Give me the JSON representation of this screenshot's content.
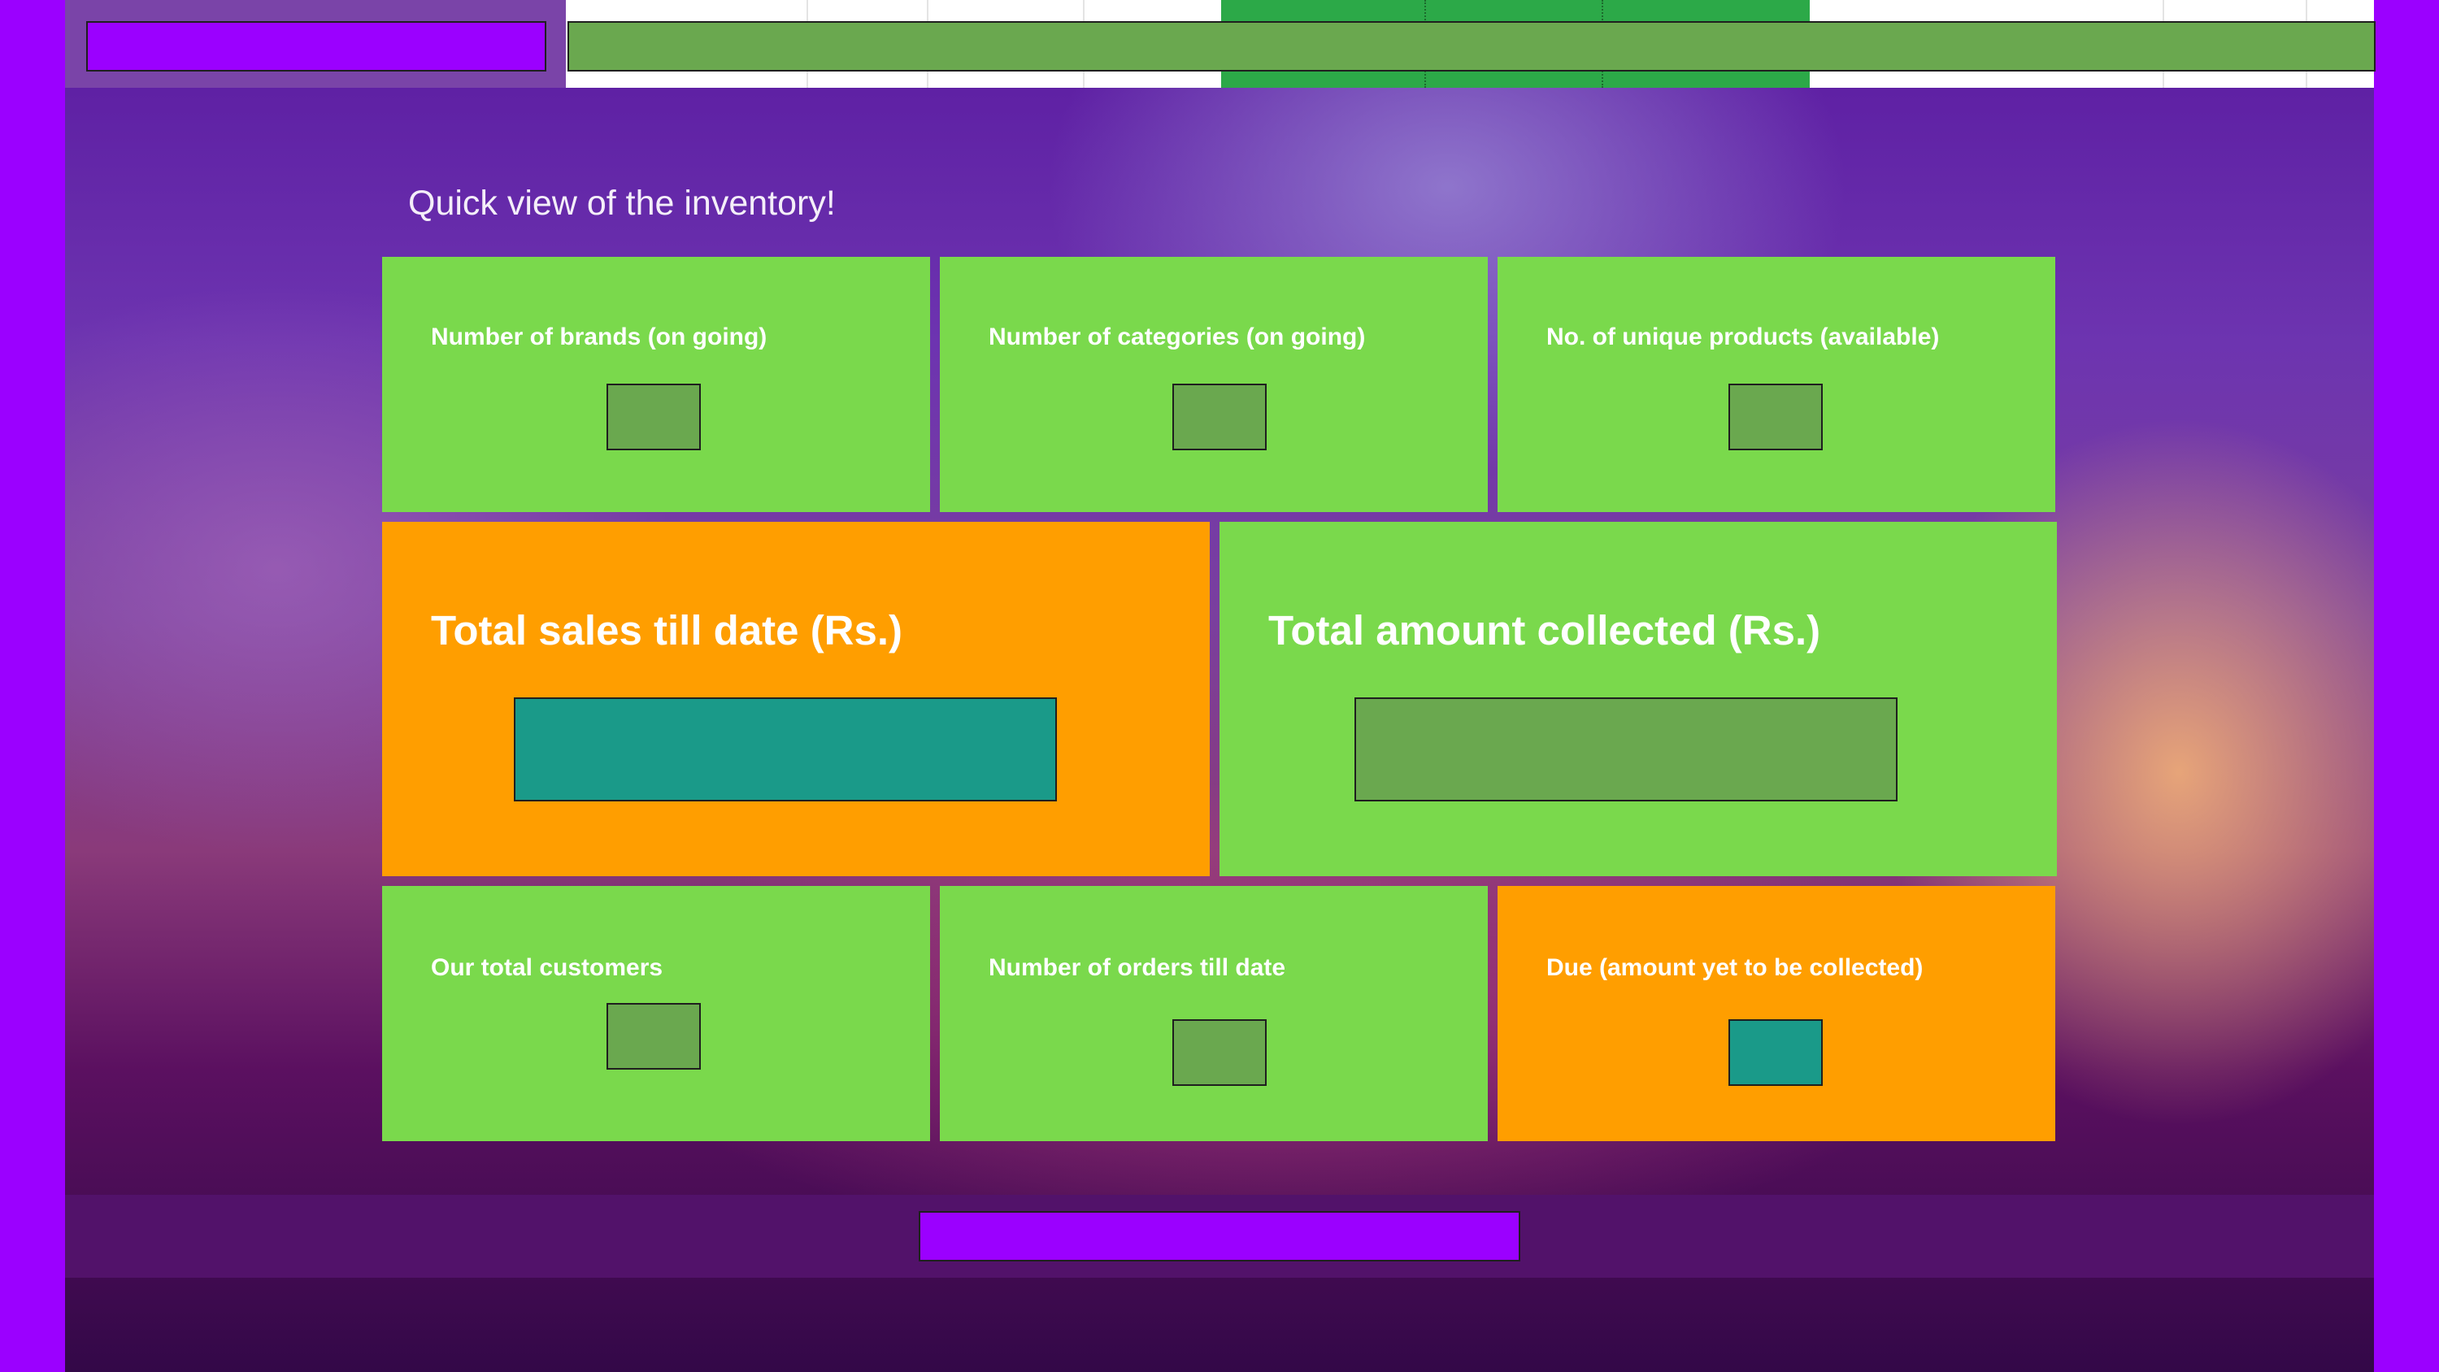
{
  "header": {
    "brand_placeholder_color": "#9b00ff",
    "nav_placeholder_color": "#6aa84f"
  },
  "main": {
    "title": "Quick view of the inventory!",
    "cards": {
      "brands": {
        "label": "Number of brands (on going)"
      },
      "categories": {
        "label": "Number of categories (on going)"
      },
      "unique_products": {
        "label": "No. of unique products (available)"
      },
      "total_sales": {
        "label": "Total sales till date (Rs.)"
      },
      "amount_collected": {
        "label": "Total amount collected (Rs.)"
      },
      "customers": {
        "label": "Our total customers"
      },
      "orders": {
        "label": "Number of orders till date"
      },
      "due": {
        "label": "Due (amount yet to be collected)"
      }
    }
  },
  "colors": {
    "card_green": "#7ad94c",
    "card_orange": "#ff9e00",
    "value_olive": "#6aa84f",
    "value_teal": "#1a9a89",
    "accent_purple": "#9b00ff"
  }
}
